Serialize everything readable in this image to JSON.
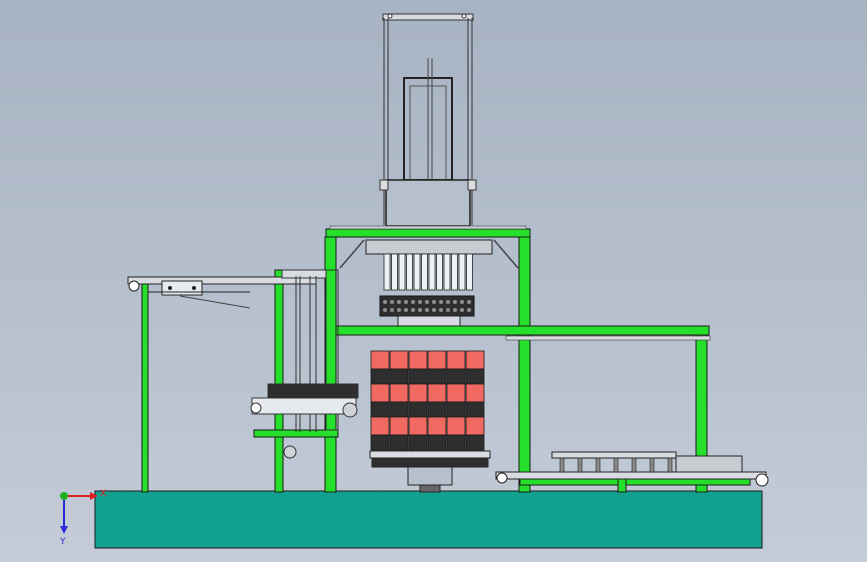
{
  "colors": {
    "frame_green": "#25e02a",
    "base_teal": "#12a190",
    "crate_red": "#f06a62",
    "crate_dark": "#2e2e2e",
    "steel": "#c8ccd2",
    "outline": "#1a1a1a",
    "axis_x": "#e02020",
    "axis_y": "#2a2ad8",
    "axis_z": "#20b020"
  },
  "axis_triad": {
    "x_label": "X",
    "y_label": "Y"
  }
}
